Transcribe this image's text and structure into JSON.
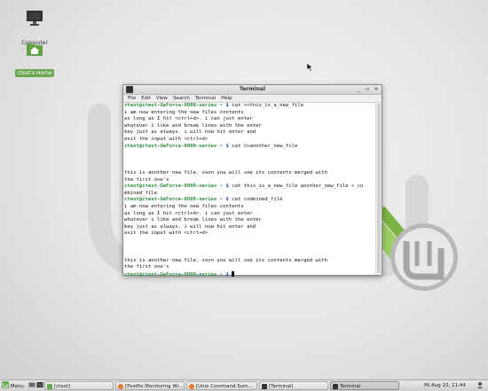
{
  "desktop": {
    "icons": [
      {
        "label": "Computer"
      },
      {
        "label": "ctest's Home"
      }
    ]
  },
  "window": {
    "title": "Terminal",
    "menu": [
      "File",
      "Edit",
      "View",
      "Search",
      "Terminal",
      "Help"
    ],
    "prompt": "ctest@ctest-GeForce-8000-series",
    "lines": [
      {
        "type": "prompt",
        "cmd": "cat >>this_is_a_new_file"
      },
      {
        "type": "out",
        "text": "i am now entering the new files contents"
      },
      {
        "type": "out",
        "text": "as long as I hit <ctrl+d>. i can just enter"
      },
      {
        "type": "out",
        "text": "whatever i like and break lines with the enter"
      },
      {
        "type": "out",
        "text": "key just as always. i will now hit enter and"
      },
      {
        "type": "out",
        "text": "exit the input with <ctrl+d>"
      },
      {
        "type": "prompt",
        "cmd": "cat >>another_new_file"
      },
      {
        "type": "out",
        "text": ""
      },
      {
        "type": "out",
        "text": ""
      },
      {
        "type": "out",
        "text": ""
      },
      {
        "type": "out",
        "text": "this is another new file. soon you will see its contents merged with"
      },
      {
        "type": "out",
        "text": "the first one's"
      },
      {
        "type": "prompt",
        "cmd": "cat this_is_a_new_file another_new_file > co"
      },
      {
        "type": "out",
        "text": "mbined_file"
      },
      {
        "type": "prompt",
        "cmd": "cat combined_file"
      },
      {
        "type": "out",
        "text": "i am now entering the new files contents"
      },
      {
        "type": "out",
        "text": "as long as I hit <ctrl+d>. i can just enter"
      },
      {
        "type": "out",
        "text": "whatever i like and break lines with the enter"
      },
      {
        "type": "out",
        "text": "key just as always. i will now hit enter and"
      },
      {
        "type": "out",
        "text": "exit the input with <ctrl+d>"
      },
      {
        "type": "out",
        "text": ""
      },
      {
        "type": "out",
        "text": ""
      },
      {
        "type": "out",
        "text": ""
      },
      {
        "type": "out",
        "text": "this is another new file. soon you will see its contents merged with"
      },
      {
        "type": "out",
        "text": "the first one's"
      },
      {
        "type": "prompt",
        "cmd": "",
        "cursor": true
      }
    ]
  },
  "taskbar": {
    "menu_label": "Menu",
    "tasks": [
      {
        "label": "[ctest]",
        "active": false,
        "color": "#6aa84f"
      },
      {
        "label": "[Postfix Monitoring Wi...",
        "active": false,
        "color": "#e8772e"
      },
      {
        "label": "[Unix Command Sum...",
        "active": false,
        "color": "#e8772e"
      },
      {
        "label": "[Terminal]",
        "active": false,
        "color": "#333333"
      },
      {
        "label": "Terminal",
        "active": true,
        "color": "#333333"
      }
    ],
    "clock": "Mi Aug 10, 11:44"
  }
}
